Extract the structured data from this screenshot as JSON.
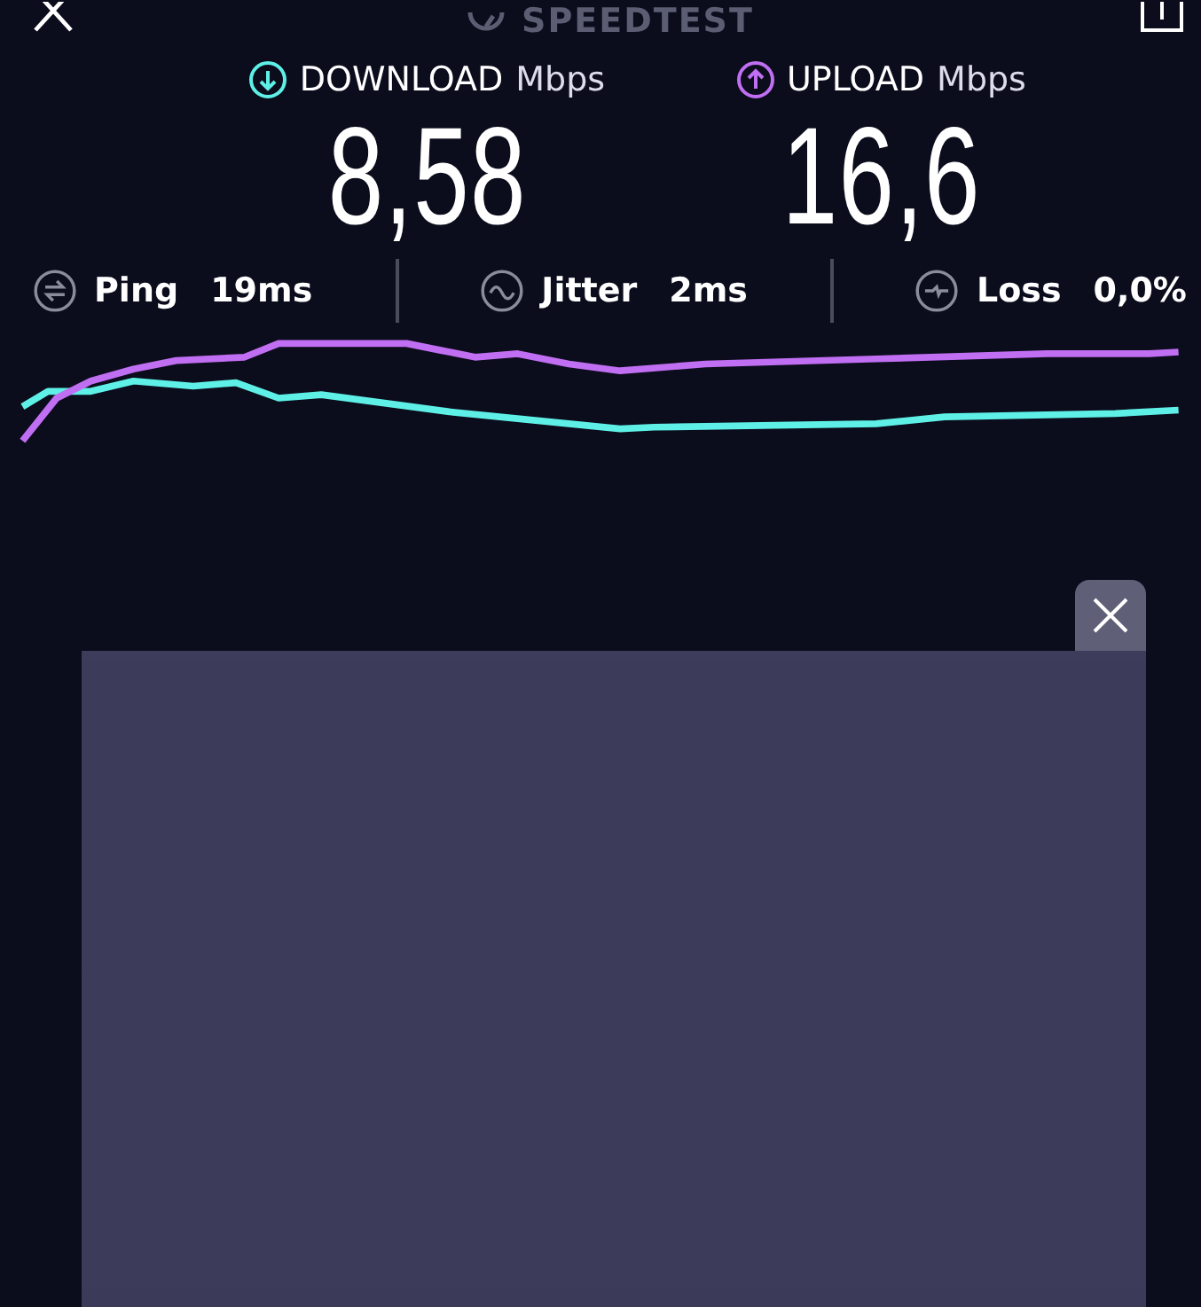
{
  "header": {
    "title": "SPEEDTEST"
  },
  "results": [
    {
      "kind": "download",
      "label": "DOWNLOAD",
      "unit": "Mbps",
      "value": "8,58",
      "color": "#5ef0e6"
    },
    {
      "kind": "upload",
      "label": "UPLOAD",
      "unit": "Mbps",
      "value": "16,6",
      "color": "#c06ef2"
    }
  ],
  "stats": [
    {
      "kind": "ping",
      "label": "Ping",
      "value": "19ms"
    },
    {
      "kind": "jitter",
      "label": "Jitter",
      "value": "2ms"
    },
    {
      "kind": "loss",
      "label": "Loss",
      "value": "0,0%"
    }
  ]
}
